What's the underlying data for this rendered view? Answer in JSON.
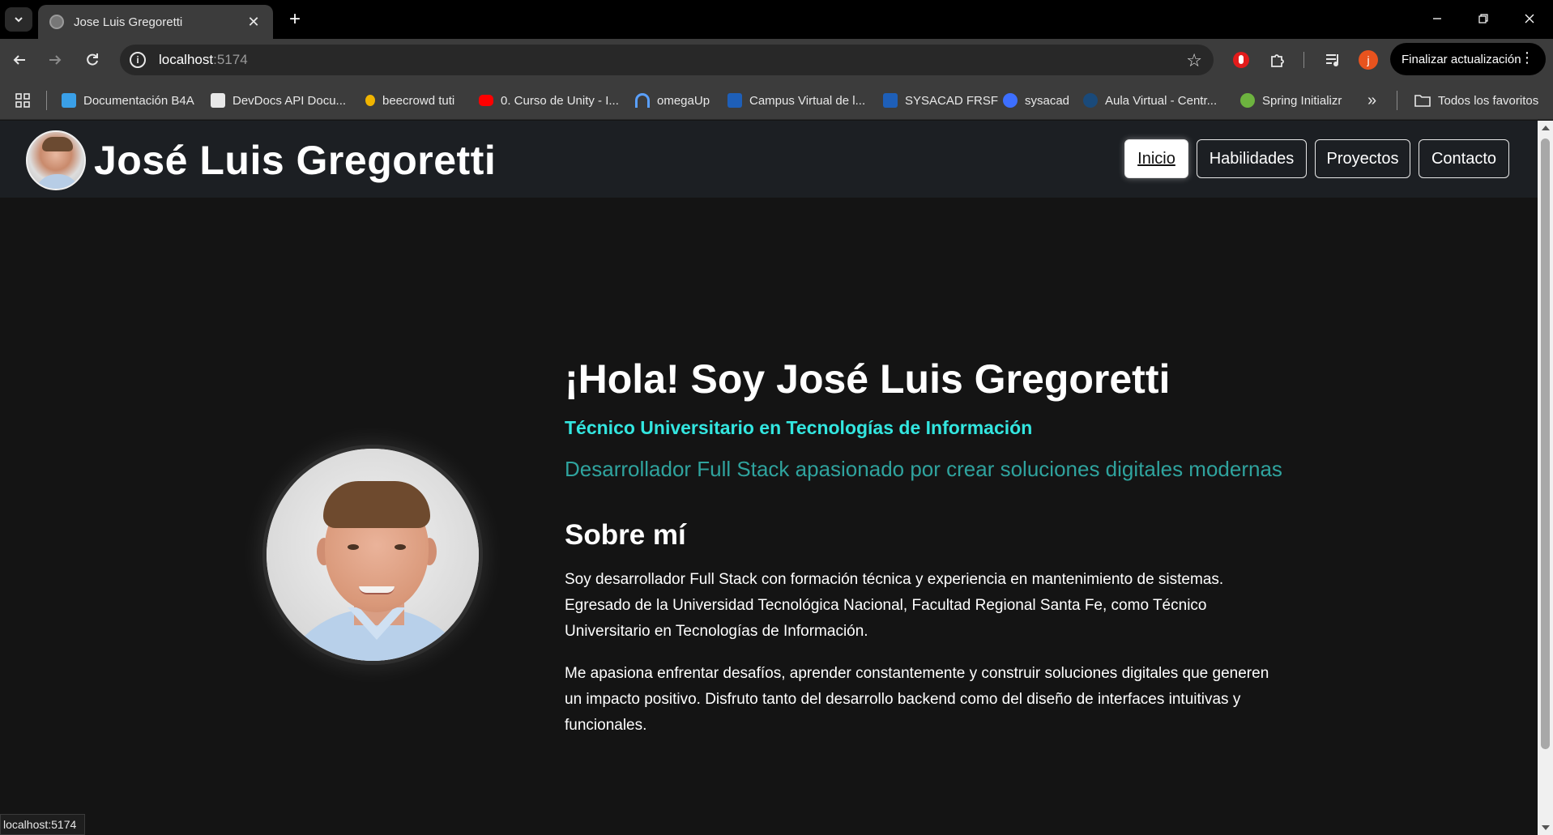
{
  "browser": {
    "tab_title": "Jose Luis Gregoretti",
    "new_tab_symbol": "+",
    "close_symbol": "✕",
    "url_host": "localhost",
    "url_port": ":5174",
    "update_label": "Finalizar actualización",
    "bookmarks": [
      {
        "label": "Documentación B4A",
        "color": "#3aa0e8"
      },
      {
        "label": "DevDocs API Docu...",
        "color": "#e8e8e8"
      },
      {
        "label": "beecrowd tuti",
        "color": "#f0b400"
      },
      {
        "label": "0. Curso de Unity - I...",
        "color": "#ff0000"
      },
      {
        "label": "omegaUp",
        "color": "#5aa0ff"
      },
      {
        "label": "Campus Virtual de l...",
        "color": "#1e5fb8"
      },
      {
        "label": "SYSACAD FRSF",
        "color": "#1e5fb8"
      },
      {
        "label": "sysacad",
        "color": "#3d6fff"
      },
      {
        "label": "Aula Virtual - Centr...",
        "color": "#1a4a7a"
      },
      {
        "label": "Spring Initializr",
        "color": "#6db33f"
      }
    ],
    "bookmarks_overflow": "»",
    "all_bookmarks_label": "Todos los favoritos",
    "status_text": "localhost:5174",
    "profile_initial": "j"
  },
  "site": {
    "title": "José Luis Gregoretti",
    "nav": [
      "Inicio",
      "Habilidades",
      "Proyectos",
      "Contacto"
    ]
  },
  "hero": {
    "greeting": "¡Hola! Soy José Luis Gregoretti",
    "role": "Técnico Universitario en Tecnologías de Información",
    "tagline": "Desarrollador Full Stack apasionado por crear soluciones digitales modernas"
  },
  "about": {
    "title": "Sobre mí",
    "p1": "Soy desarrollador Full Stack con formación técnica y experiencia en mantenimiento de sistemas. Egresado de la Universidad Tecnológica Nacional, Facultad Regional Santa Fe, como Técnico Universitario en Tecnologías de Información.",
    "p2": "Me apasiona enfrentar desafíos, aprender constantemente y construir soluciones digitales que generen un impacto positivo. Disfruto tanto del desarrollo backend como del diseño de interfaces intuitivas y funcionales."
  },
  "colors": {
    "accent_role": "#33e6e0",
    "accent_tagline": "#2fa39e",
    "header_bg": "#1c1f23",
    "page_bg": "#141414"
  }
}
